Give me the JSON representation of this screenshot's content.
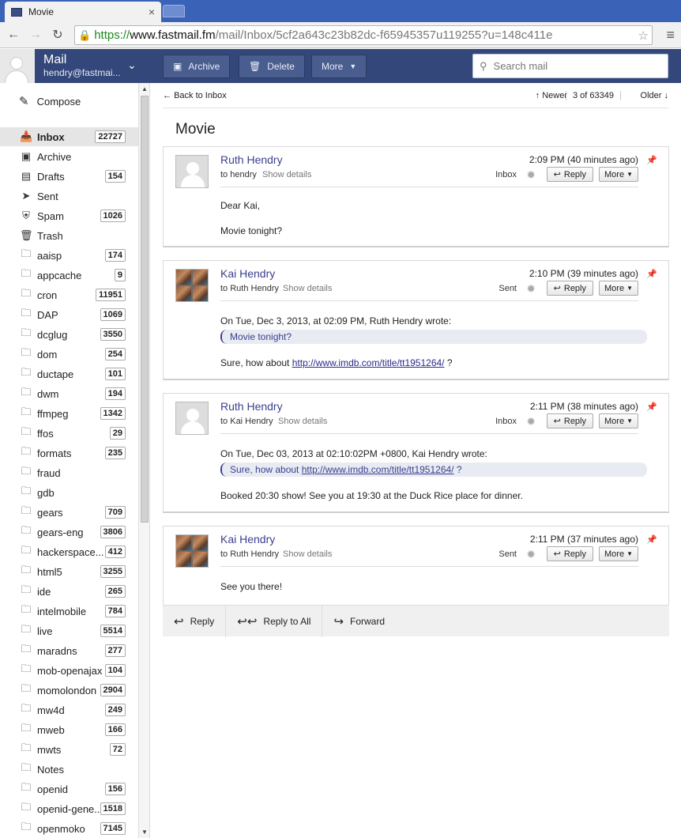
{
  "browser": {
    "tab_title": "Movie",
    "url_https": "https://",
    "url_host": "www.fastmail.fm",
    "url_path": "/mail/Inbox/5cf2a643c23b82dc-f65945357u119255?u=148c411e"
  },
  "header": {
    "app_name": "Mail",
    "account_email": "hendry@fastmai...",
    "archive_label": "Archive",
    "delete_label": "Delete",
    "more_label": "More",
    "search_placeholder": "Search mail"
  },
  "sidebar": {
    "compose_label": "Compose",
    "folders": [
      {
        "label": "Inbox",
        "count": "22727",
        "icon": "inbox-icon",
        "active": true
      },
      {
        "label": "Archive",
        "count": "",
        "icon": "archive-icon"
      },
      {
        "label": "Drafts",
        "count": "154",
        "icon": "drafts-icon"
      },
      {
        "label": "Sent",
        "count": "",
        "icon": "sent-icon"
      },
      {
        "label": "Spam",
        "count": "1026",
        "icon": "spam-icon"
      },
      {
        "label": "Trash",
        "count": "",
        "icon": "trash-icon"
      },
      {
        "label": "aaisp",
        "count": "174",
        "icon": "folder-icon"
      },
      {
        "label": "appcache",
        "count": "9",
        "icon": "folder-icon"
      },
      {
        "label": "cron",
        "count": "11951",
        "icon": "folder-icon"
      },
      {
        "label": "DAP",
        "count": "1069",
        "icon": "folder-icon"
      },
      {
        "label": "dcglug",
        "count": "3550",
        "icon": "folder-icon"
      },
      {
        "label": "dom",
        "count": "254",
        "icon": "folder-icon"
      },
      {
        "label": "ductape",
        "count": "101",
        "icon": "folder-icon"
      },
      {
        "label": "dwm",
        "count": "194",
        "icon": "folder-icon"
      },
      {
        "label": "ffmpeg",
        "count": "1342",
        "icon": "folder-icon"
      },
      {
        "label": "ffos",
        "count": "29",
        "icon": "folder-icon"
      },
      {
        "label": "formats",
        "count": "235",
        "icon": "folder-icon"
      },
      {
        "label": "fraud",
        "count": "",
        "icon": "folder-icon"
      },
      {
        "label": "gdb",
        "count": "",
        "icon": "folder-icon"
      },
      {
        "label": "gears",
        "count": "709",
        "icon": "folder-icon"
      },
      {
        "label": "gears-eng",
        "count": "3806",
        "icon": "folder-icon"
      },
      {
        "label": "hackerspace...",
        "count": "412",
        "icon": "folder-icon"
      },
      {
        "label": "html5",
        "count": "3255",
        "icon": "folder-icon"
      },
      {
        "label": "ide",
        "count": "265",
        "icon": "folder-icon"
      },
      {
        "label": "intelmobile",
        "count": "784",
        "icon": "folder-icon"
      },
      {
        "label": "live",
        "count": "5514",
        "icon": "folder-icon"
      },
      {
        "label": "maradns",
        "count": "277",
        "icon": "folder-icon"
      },
      {
        "label": "mob-openajax",
        "count": "104",
        "icon": "folder-icon"
      },
      {
        "label": "momolondon",
        "count": "2904",
        "icon": "folder-icon"
      },
      {
        "label": "mw4d",
        "count": "249",
        "icon": "folder-icon"
      },
      {
        "label": "mweb",
        "count": "166",
        "icon": "folder-icon"
      },
      {
        "label": "mwts",
        "count": "72",
        "icon": "folder-icon"
      },
      {
        "label": "Notes",
        "count": "",
        "icon": "folder-icon"
      },
      {
        "label": "openid",
        "count": "156",
        "icon": "folder-icon"
      },
      {
        "label": "openid-gene...",
        "count": "1518",
        "icon": "folder-icon"
      },
      {
        "label": "openmoko",
        "count": "7145",
        "icon": "folder-icon"
      }
    ]
  },
  "nav": {
    "back_label": "Back to Inbox",
    "newer_label": "Newer",
    "position": "3 of 63349",
    "older_label": "Older"
  },
  "thread": {
    "subject": "Movie",
    "messages": [
      {
        "from": "Ruth Hendry",
        "to": "to hendry",
        "show_details": "Show details",
        "time": "2:09 PM (40 minutes ago)",
        "folder": "Inbox",
        "reply": "Reply",
        "more": "More",
        "greeting": "Dear Kai,",
        "text": "Movie tonight?"
      },
      {
        "from": "Kai Hendry",
        "to": "to Ruth Hendry",
        "show_details": "Show details",
        "time": "2:10 PM (39 minutes ago)",
        "folder": "Sent",
        "reply": "Reply",
        "more": "More",
        "attribution": "On Tue, Dec 3, 2013, at 02:09 PM, Ruth Hendry wrote:",
        "quote": "Movie tonight?",
        "text_pre": "Sure, how about ",
        "link": "http://www.imdb.com/title/tt1951264/",
        "text_post": " ?"
      },
      {
        "from": "Ruth Hendry",
        "to": "to Kai Hendry",
        "show_details": "Show details",
        "time": "2:11 PM (38 minutes ago)",
        "folder": "Inbox",
        "reply": "Reply",
        "more": "More",
        "attribution": "On Tue, Dec 03, 2013 at 02:10:02PM +0800, Kai Hendry wrote:",
        "quote_pre": "Sure, how about ",
        "quote_link": "http://www.imdb.com/title/tt1951264/",
        "quote_post": " ?",
        "text": "Booked 20:30 show! See you at 19:30 at the Duck Rice place for dinner."
      },
      {
        "from": "Kai Hendry",
        "to": "to Ruth Hendry",
        "show_details": "Show details",
        "time": "2:11 PM (37 minutes ago)",
        "folder": "Sent",
        "reply": "Reply",
        "more": "More",
        "text": "See you there!"
      }
    ],
    "footer": {
      "reply": "Reply",
      "reply_all": "Reply to All",
      "forward": "Forward"
    }
  },
  "colors": {
    "header_bg": "#34477a",
    "tabbar_bg": "#3a63b8",
    "sender_name": "#3a3f8e"
  }
}
